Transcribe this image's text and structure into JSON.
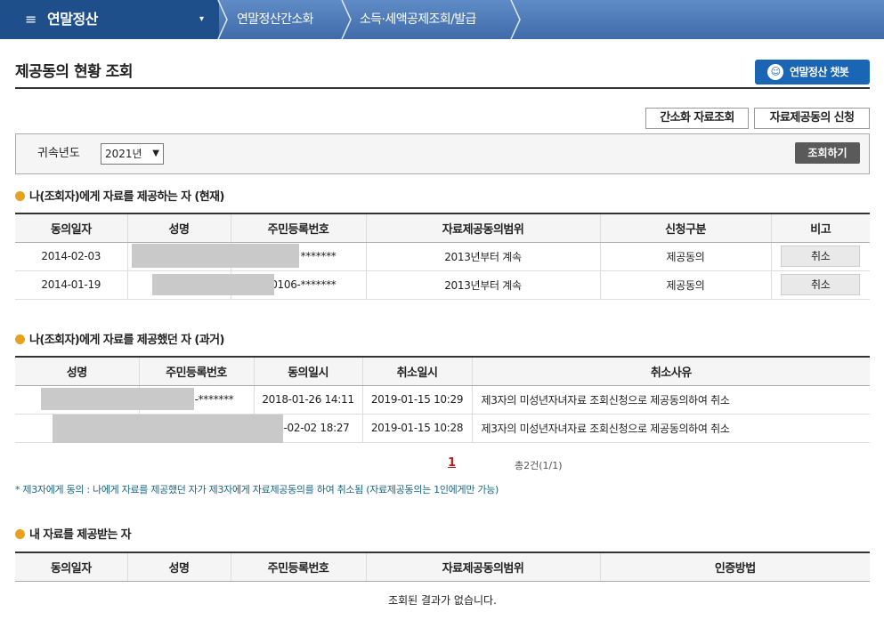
{
  "nav": {
    "menu_icon": "≡",
    "menu_title": "연말정산",
    "caret": "▾",
    "crumb1": "연말정산간소화",
    "crumb2": "소득·세액공제조회/발급"
  },
  "page": {
    "title": "제공동의 현황 조회",
    "chatbot_label": "연말정산 챗봇",
    "chatbot_icon": "chatbot-icon"
  },
  "actions": {
    "simple_data": "간소화 자료조회",
    "consent_apply": "자료제공동의 신청"
  },
  "search": {
    "year_label": "귀속년도",
    "year_value": "2021년",
    "search_button": "조회하기"
  },
  "current": {
    "title": "나(조회자)에게 자료를 제공하는 자 (현재)",
    "headers": [
      "동의일자",
      "성명",
      "주민등록번호",
      "자료제공동의범위",
      "신청구분",
      "비고"
    ],
    "rows": [
      {
        "date": "2014-02-03",
        "name": "",
        "rrn": "*******",
        "scope": "2013년부터 계속",
        "type": "제공동의",
        "action": "취소"
      },
      {
        "date": "2014-01-19",
        "name": "",
        "rrn": "0106-*******",
        "scope": "2013년부터 계속",
        "type": "제공동의",
        "action": "취소"
      }
    ]
  },
  "past": {
    "title": "나(조회자)에게 자료를 제공했던 자 (과거)",
    "headers": [
      "성명",
      "주민등록번호",
      "동의일시",
      "취소일시",
      "취소사유"
    ],
    "rows": [
      {
        "name": "",
        "rrn": "-*******",
        "consent": "2018-01-26 14:11",
        "cancel": "2019-01-15 10:29",
        "reason": "제3자의 미성년자녀자료 조회신청으로 제공동의하여 취소"
      },
      {
        "name": "",
        "rrn": "",
        "consent": "5-02-02 18:27",
        "cancel": "2019-01-15 10:28",
        "reason": "제3자의 미성년자녀자료 조회신청으로 제공동의하여 취소"
      }
    ],
    "page": "1",
    "total": "총2건(1/1)",
    "note": "* 제3자에게 동의 : 나에게 자료를 제공했던 자가 제3자에게 자료제공동의를 하여 취소됨 (자료제공동의는 1인에게만 가능)"
  },
  "receivers": {
    "title": "내 자료를 제공받는 자",
    "headers": [
      "동의일자",
      "성명",
      "주민등록번호",
      "자료제공동의범위",
      "인증방법"
    ],
    "empty": "조회된 결과가 없습니다."
  },
  "colors": {
    "nav_bar": "#4a78b5",
    "nav_main": "#1f4f8a",
    "chatbot": "#1a66b5",
    "bullet": "#e9a01c",
    "page_link": "#b22222",
    "note": "#1a6685"
  }
}
